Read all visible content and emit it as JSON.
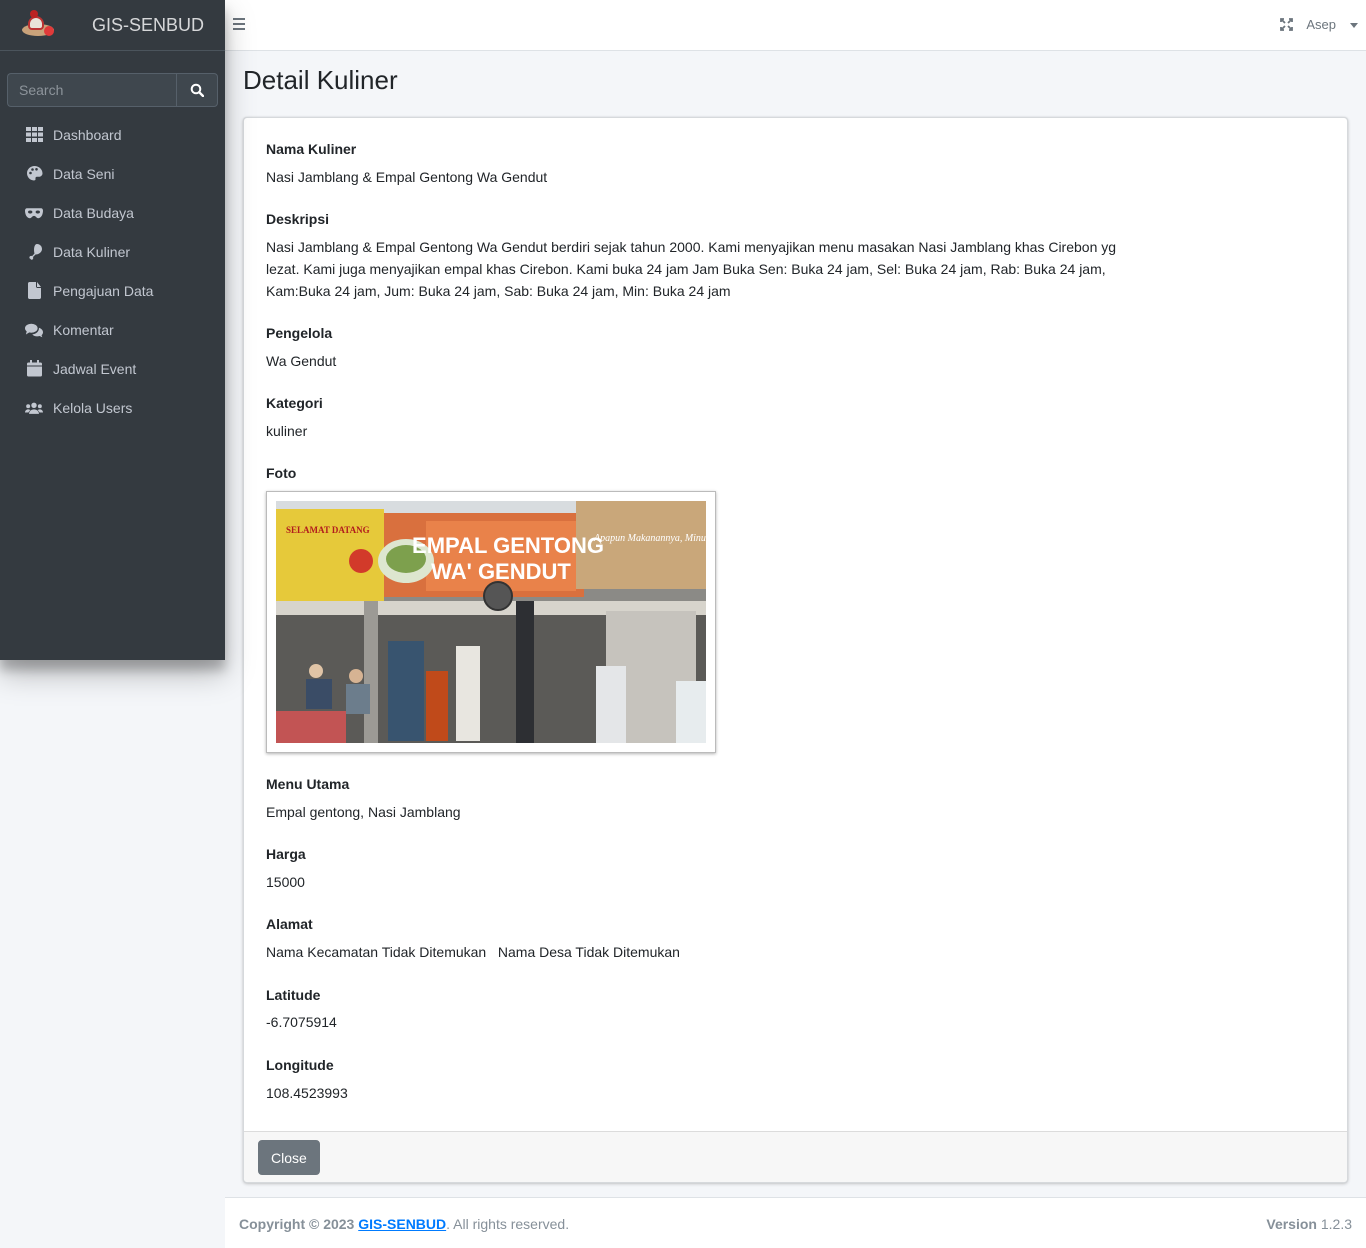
{
  "brand": {
    "name": "GIS-SENBUD"
  },
  "search": {
    "placeholder": "Search"
  },
  "sidebar": {
    "items": [
      {
        "label": "Dashboard",
        "icon": "grid-icon"
      },
      {
        "label": "Data Seni",
        "icon": "palette-icon"
      },
      {
        "label": "Data Budaya",
        "icon": "mask-icon"
      },
      {
        "label": "Data Kuliner",
        "icon": "drumstick-icon"
      },
      {
        "label": "Pengajuan Data",
        "icon": "file-icon"
      },
      {
        "label": "Komentar",
        "icon": "comments-icon"
      },
      {
        "label": "Jadwal Event",
        "icon": "calendar-icon"
      },
      {
        "label": "Kelola Users",
        "icon": "users-icon"
      }
    ]
  },
  "topbar": {
    "user": "Asep"
  },
  "page": {
    "title": "Detail Kuliner"
  },
  "detail": {
    "nama_label": "Nama Kuliner",
    "nama": "Nasi Jamblang & Empal Gentong Wa Gendut",
    "deskripsi_label": "Deskripsi",
    "deskripsi": "Nasi Jamblang & Empal Gentong Wa Gendut berdiri sejak tahun 2000. Kami menyajikan menu masakan Nasi Jamblang khas Cirebon yg lezat. Kami juga menyajikan empal khas Cirebon. Kami buka 24 jam Jam Buka Sen: Buka 24 jam, Sel: Buka 24 jam, Rab: Buka 24 jam, Kam:Buka 24 jam, Jum: Buka 24 jam, Sab: Buka 24 jam, Min: Buka 24 jam",
    "pengelola_label": "Pengelola",
    "pengelola": "Wa Gendut",
    "kategori_label": "Kategori",
    "kategori": "kuliner",
    "foto_label": "Foto",
    "foto_sign_1": "EMPAL GENTONG",
    "foto_sign_2": "WA' GENDUT",
    "foto_sign_3": "SELAMAT DATANG",
    "foto_sign_4": "Apapun Makanannya, Minumnya...",
    "menu_label": "Menu Utama",
    "menu": "Empal gentong, Nasi Jamblang",
    "harga_label": "Harga",
    "harga": "15000",
    "alamat_label": "Alamat",
    "alamat": "Nama Kecamatan Tidak Ditemukan   Nama Desa Tidak Ditemukan",
    "latitude_label": "Latitude",
    "latitude": "-6.7075914",
    "longitude_label": "Longitude",
    "longitude": "108.4523993"
  },
  "actions": {
    "close": "Close"
  },
  "footer": {
    "copyright": "Copyright © 2023",
    "link": "GIS-SENBUD",
    "rights": ". All rights reserved.",
    "version_label": "Version",
    "version": "1.2.3"
  }
}
